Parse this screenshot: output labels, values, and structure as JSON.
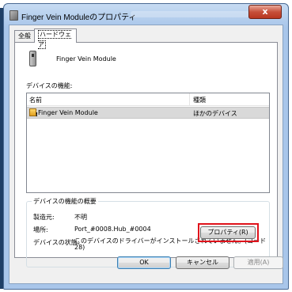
{
  "window": {
    "title": "Finger Vein Moduleのプロパティ",
    "close_label": "x"
  },
  "tabs": [
    {
      "label": "全般"
    },
    {
      "label": "ハードウェア"
    }
  ],
  "device": {
    "name": "Finger Vein Module"
  },
  "functions": {
    "label": "デバイスの機能:",
    "headers": [
      "名前",
      "種類"
    ],
    "rows": [
      {
        "name": "Finger Vein Module",
        "type": "ほかのデバイス"
      }
    ]
  },
  "summary": {
    "title": "デバイスの機能の概要",
    "manufacturer_label": "製造元:",
    "manufacturer_value": "不明",
    "location_label": "場所:",
    "location_value": "Port_#0008.Hub_#0004",
    "status_label": "デバイスの状態:",
    "status_value": "このデバイスのドライバーがインストールされていません。(コード 28)",
    "properties_button": "プロパティ(R)"
  },
  "footer": {
    "ok": "OK",
    "cancel": "キャンセル",
    "apply": "適用(A)"
  }
}
